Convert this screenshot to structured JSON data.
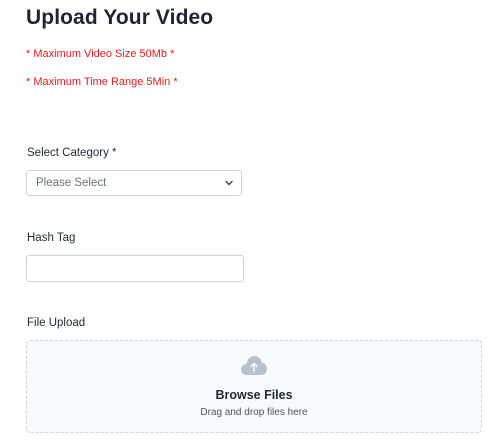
{
  "page": {
    "title": "Upload Your Video"
  },
  "notes": {
    "max_size": "* Maximum Video Size 50Mb *",
    "max_time": "* Maximum Time Range 5Min *"
  },
  "category": {
    "label": "Select Category *",
    "selected": "Please Select"
  },
  "hashtag": {
    "label": "Hash Tag",
    "value": "",
    "placeholder": ""
  },
  "upload": {
    "label": "File Upload",
    "browse_title": "Browse Files",
    "browse_subtitle": "Drag and drop files here",
    "icon": "cloud-upload-icon"
  },
  "colors": {
    "note_red": "#e11d1d",
    "icon_gray": "#b8c0cc",
    "border": "#cfd4dc"
  }
}
